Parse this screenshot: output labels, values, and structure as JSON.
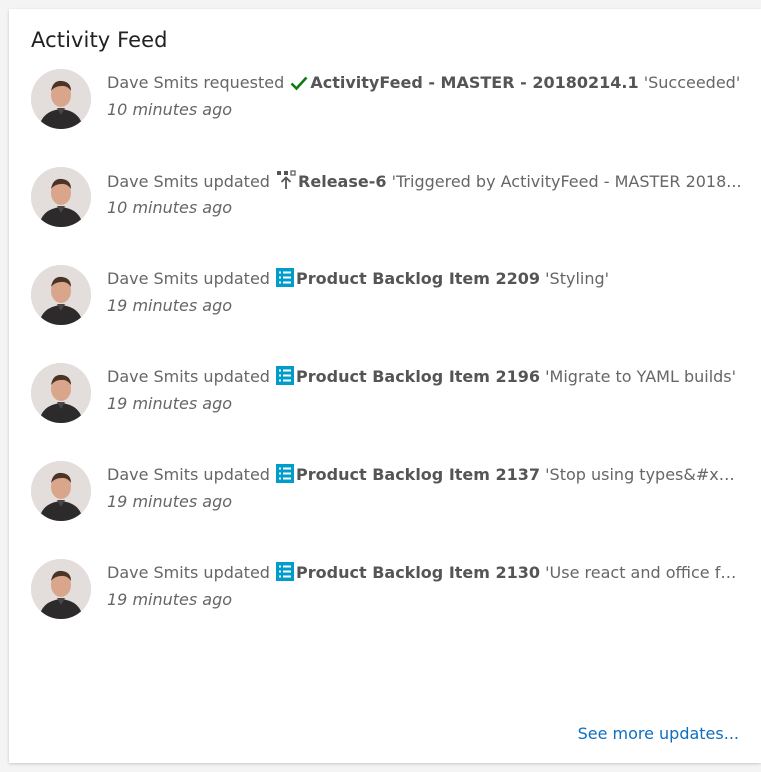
{
  "title": "Activity Feed",
  "items": [
    {
      "user": "Dave Smits",
      "action": "requested",
      "icon": "check-icon",
      "entity": "ActivityFeed - MASTER - 20180214.1",
      "detail": "'Succeeded'",
      "time": "10 minutes ago"
    },
    {
      "user": "Dave Smits",
      "action": "updated",
      "icon": "release-icon",
      "entity": "Release-6",
      "detail": "'Triggered by ActivityFeed - MASTER 2018...",
      "time": "10 minutes ago"
    },
    {
      "user": "Dave Smits",
      "action": "updated",
      "icon": "backlog-item-icon",
      "entity": "Product Backlog Item 2209",
      "detail": "'Styling'",
      "time": "19 minutes ago"
    },
    {
      "user": "Dave Smits",
      "action": "updated",
      "icon": "backlog-item-icon",
      "entity": "Product Backlog Item 2196",
      "detail": "'Migrate to YAML builds'",
      "time": "19 minutes ago"
    },
    {
      "user": "Dave Smits",
      "action": "updated",
      "icon": "backlog-item-icon",
      "entity": "Product Backlog Item 2137",
      "detail": "'Stop using types&#x2F;...",
      "time": "19 minutes ago"
    },
    {
      "user": "Dave Smits",
      "action": "updated",
      "icon": "backlog-item-icon",
      "entity": "Product Backlog Item 2130",
      "detail": "'Use react and office fab...",
      "time": "19 minutes ago"
    }
  ],
  "see_more": "See more updates...",
  "colors": {
    "link": "#106ebe",
    "success": "#107c10",
    "backlog": "#009ccc",
    "text": "#666666"
  }
}
